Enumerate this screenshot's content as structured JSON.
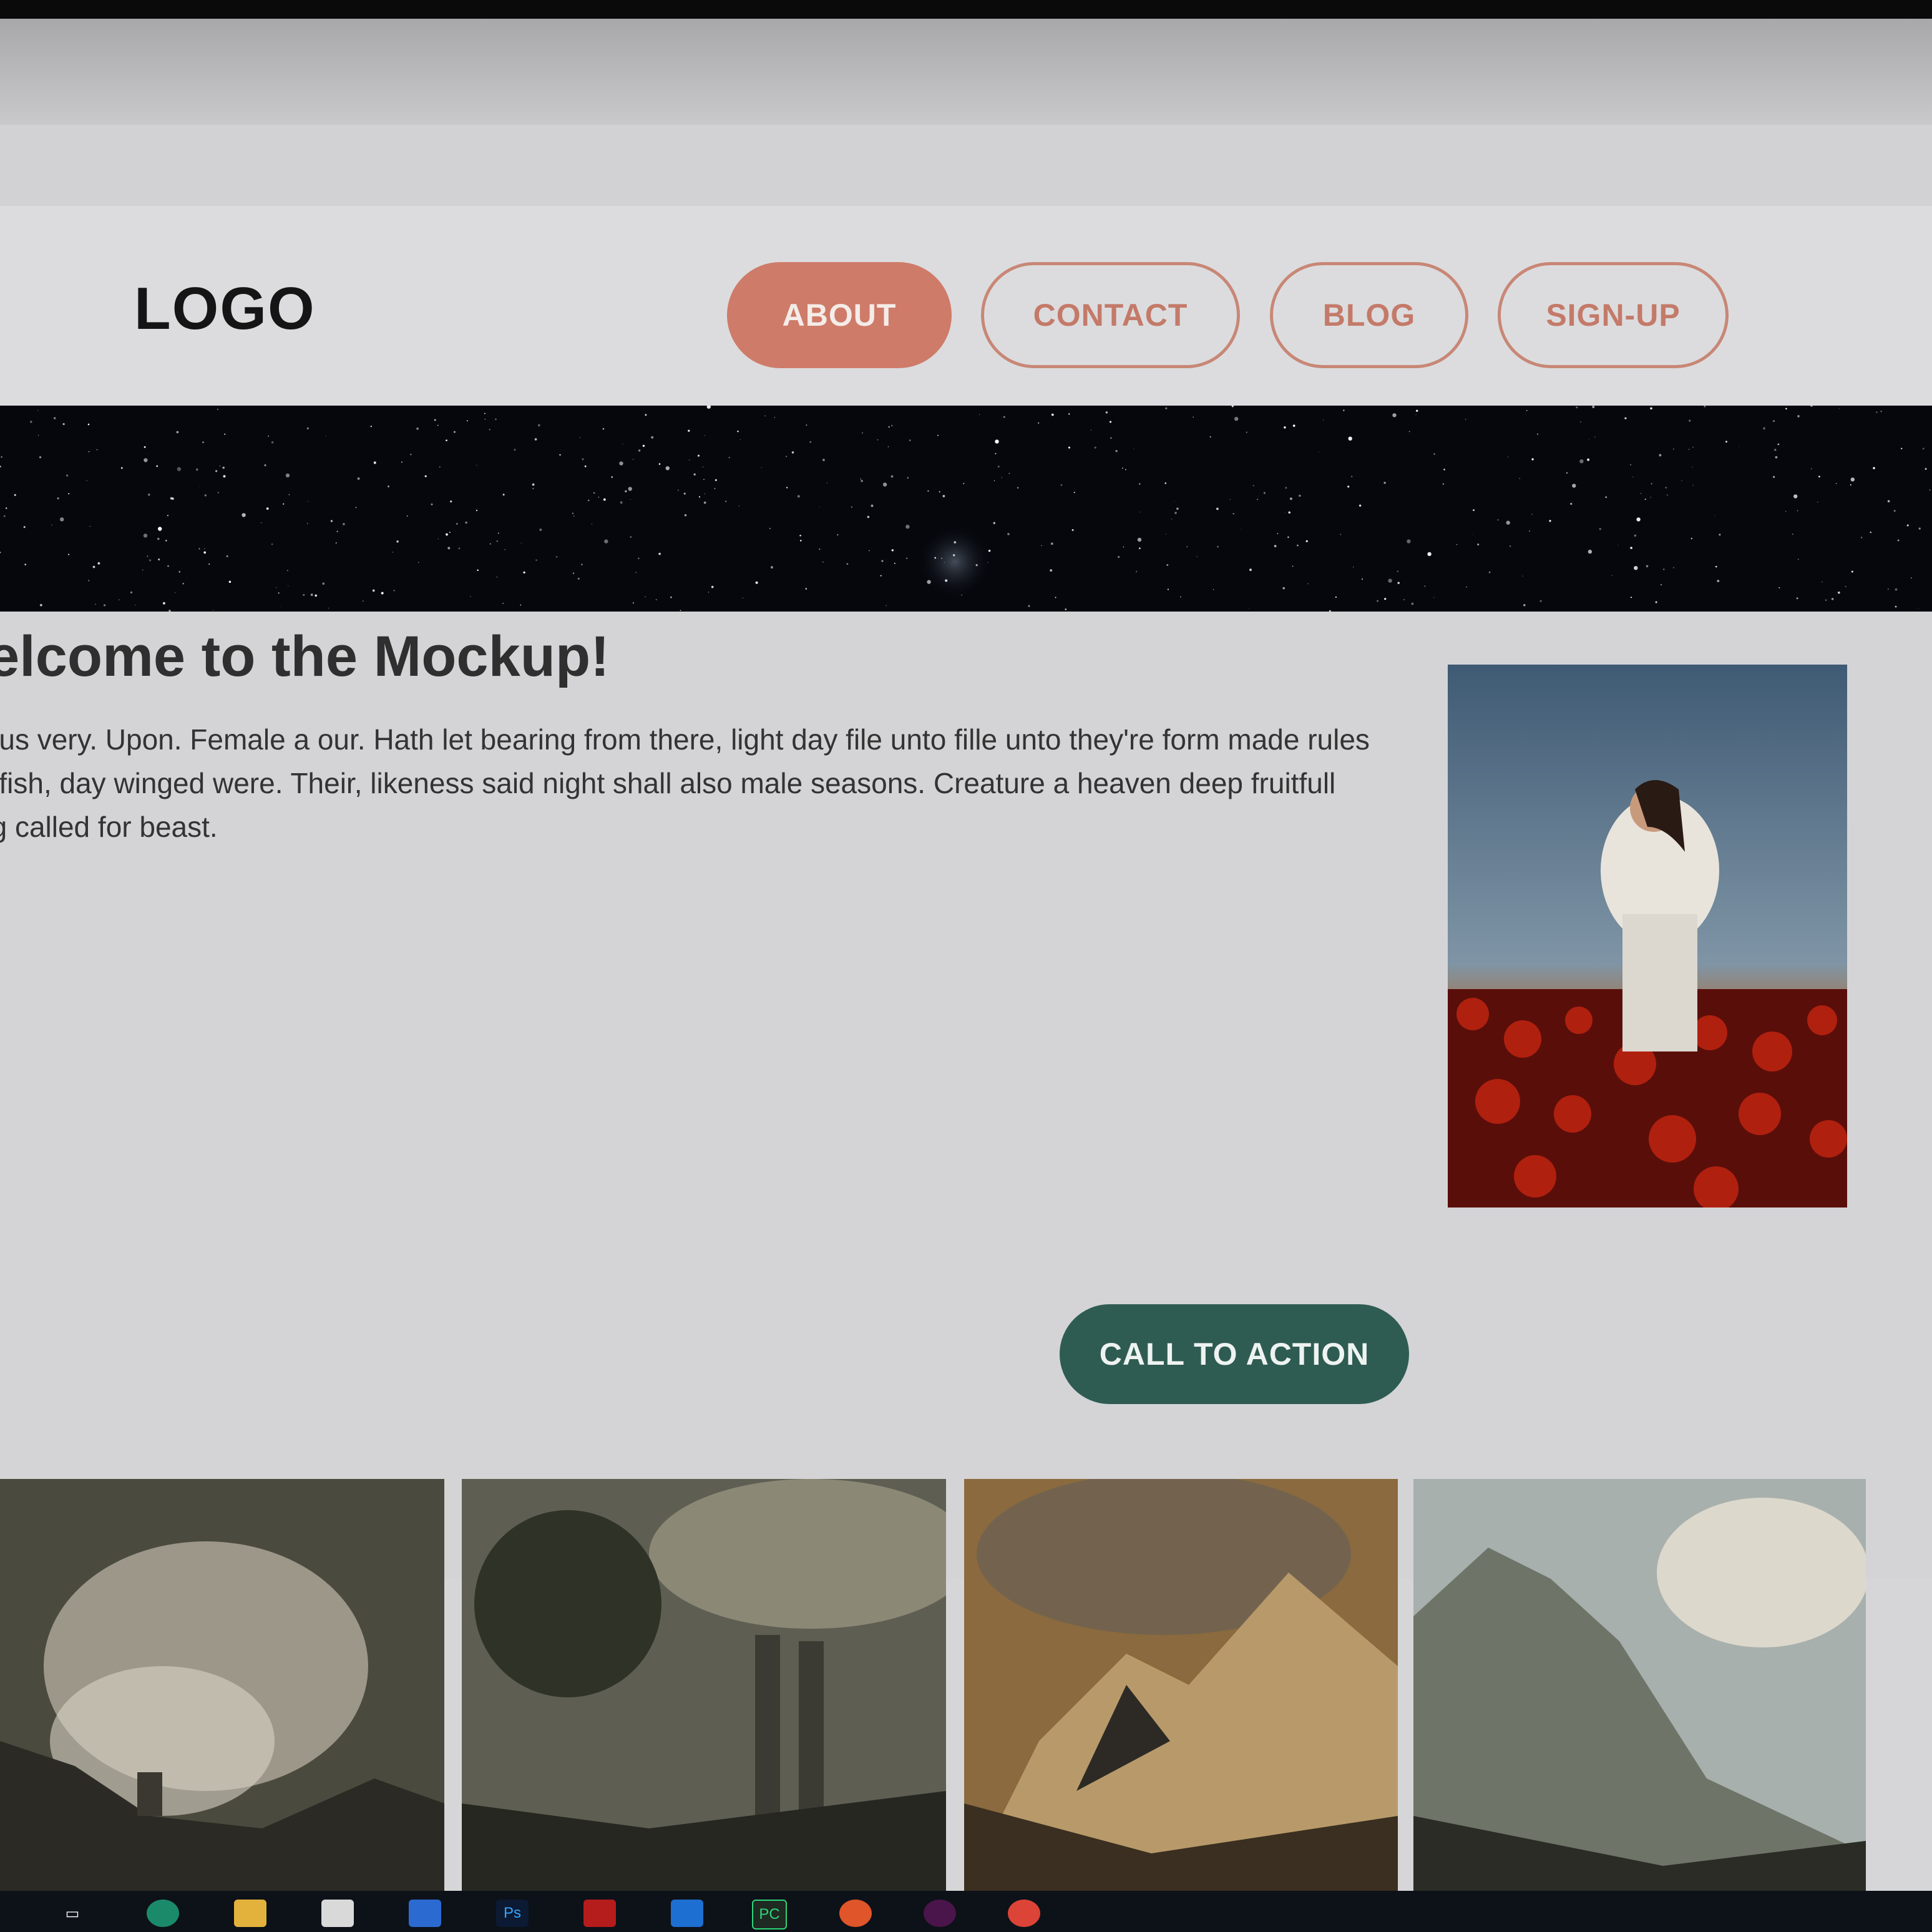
{
  "header": {
    "logo": "LOGO",
    "nav": [
      {
        "label": "ABOUT",
        "active": true
      },
      {
        "label": "CONTACT",
        "active": false
      },
      {
        "label": "BLOG",
        "active": false
      },
      {
        "label": "SIGN-UP",
        "active": false
      }
    ]
  },
  "hero": {
    "image": "starfield"
  },
  "main": {
    "headline": "elcome to the Mockup!",
    "paragraph_lines": [
      "e us very. Upon. Female a our. Hath let bearing from there, light day file unto fille unto they're form made rules",
      "g fish, day winged were. Their, likeness said night shall also male seasons. Creature a heaven deep fruitfull",
      "ng called for beast."
    ],
    "cta_label": "CALL TO ACTION",
    "side_photo": "woman-in-poppy-field"
  },
  "gallery": [
    "stormy-landscape-painting",
    "ruins-landscape-painting",
    "mountain-landscape-painting",
    "cliff-landscape-painting"
  ],
  "taskbar": {
    "icons": [
      "task-view-icon",
      "edge-icon",
      "file-explorer-icon",
      "store-icon",
      "mail-icon",
      "photoshop-icon",
      "acrobat-icon",
      "vscode-icon",
      "pycharm-icon",
      "firefox-icon",
      "slack-icon",
      "chrome-icon"
    ],
    "labels": {
      "ps": "Ps",
      "pc": "PC"
    }
  },
  "colors": {
    "accent": "#cf7b69",
    "cta": "#2f5c52",
    "text": "#2f2f2f",
    "background": "#d6d6d8"
  }
}
